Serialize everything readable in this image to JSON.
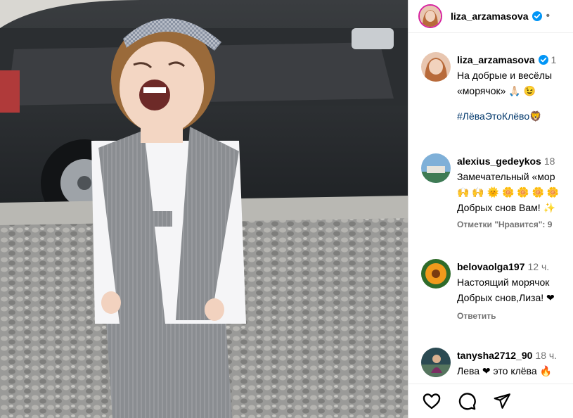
{
  "post": {
    "author": "liza_arzamasova",
    "header_dot": "•"
  },
  "caption": {
    "username": "liza_arzamasova",
    "time": "1",
    "line1": "На добрые и весёлы",
    "line2": "«морячок» 🙏🏻 😉",
    "hashtag": "#ЛёваЭтоКлёво🦁"
  },
  "comments": [
    {
      "username": "alexius_gedeykos",
      "time": "18",
      "line1": "Замечательный «мор",
      "line2": "🙌 🙌 🌞 🌼 🌼 🌼 🌼",
      "line3": "Добрых снов Вам! ✨",
      "meta": "Отметки \"Нравится\": 9"
    },
    {
      "username": "belovaolga197",
      "time": "12 ч.",
      "line1": "Настоящий морячок",
      "line2": "Добрых снов,Лиза! ❤",
      "meta": "Ответить"
    },
    {
      "username": "tanysha2712_90",
      "time": "18 ч.",
      "line1": "Лева ❤ это клёва 🔥"
    }
  ],
  "icons": [
    "like-heart-icon",
    "comment-bubble-icon",
    "share-send-icon",
    "verified-badge-icon"
  ],
  "colors": {
    "verified": "#0095f6",
    "hashtag": "#00376b",
    "secondary_text": "#737373"
  }
}
